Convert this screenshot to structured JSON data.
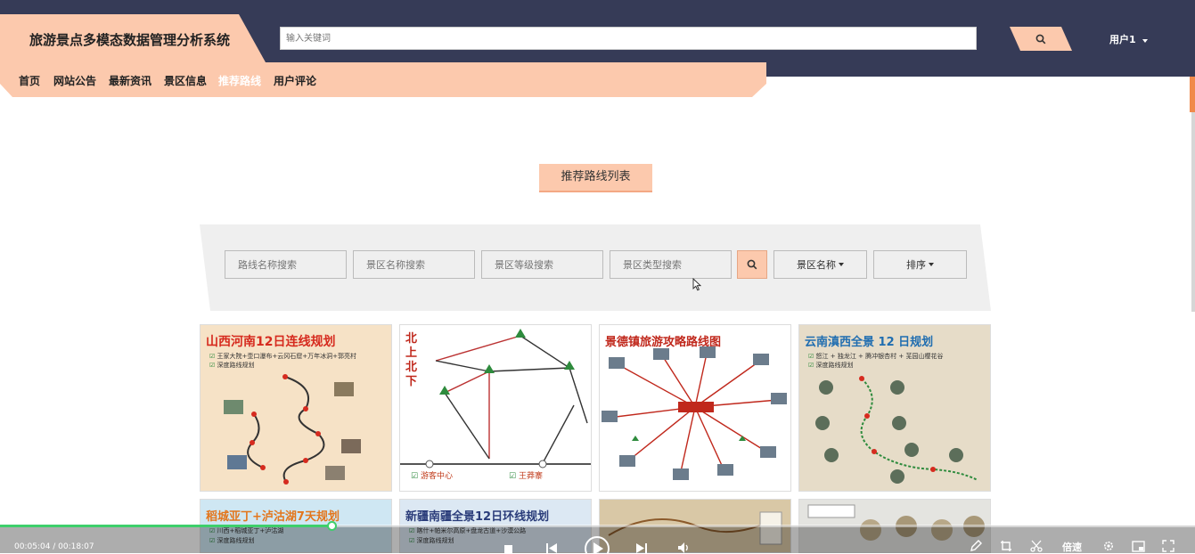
{
  "app": {
    "title": "旅游景点多模态数据管理分析系统"
  },
  "header": {
    "search_placeholder": "输入关键词",
    "user_label": "用户1"
  },
  "nav": {
    "items": [
      {
        "label": "首页",
        "active": false
      },
      {
        "label": "网站公告",
        "active": false
      },
      {
        "label": "最新资讯",
        "active": false
      },
      {
        "label": "景区信息",
        "active": false
      },
      {
        "label": "推荐路线",
        "active": true
      },
      {
        "label": "用户评论",
        "active": false
      }
    ]
  },
  "main": {
    "section_title": "推荐路线列表",
    "filters": {
      "route_name_placeholder": "路线名称搜索",
      "scenic_name_placeholder": "景区名称搜索",
      "scenic_level_placeholder": "景区等级搜索",
      "scenic_type_placeholder": "景区类型搜索",
      "scenic_dropdown_label": "景区名称",
      "sort_dropdown_label": "排序"
    },
    "cards": [
      {
        "title": "山西河南12日连线规划",
        "lines": [
          "王家大院+壶口瀑布+云冈石窟+万年冰洞+郭亮村",
          "深度路线规划"
        ],
        "title_color": "#d62b1f",
        "bg": "#f6e2c6"
      },
      {
        "title": "北上北下",
        "lines": [
          "游客中心",
          "王莽寨"
        ],
        "title_color": "#c0281c",
        "bg": "#ffffff"
      },
      {
        "title": "景德镇旅游攻略路线图",
        "lines": [],
        "title_color": "#c0281c",
        "bg": "#ffffff"
      },
      {
        "title": "云南滇西全景 12 日规划",
        "lines": [
          "怒江 + 独龙江 + 腾冲银杏村 + 芜园山樱花谷",
          "深度路线规划"
        ],
        "title_color": "#1f6db0",
        "bg": "#e6dcc8"
      },
      {
        "title": "稻城亚丁+泸沽湖7天规划",
        "lines": [
          "川西+稻城亚丁+泸沽湖",
          "深度路线规划"
        ],
        "title_color": "#e3761d",
        "bg": "#cfe7f3"
      },
      {
        "title": "新疆南疆全景12日环线规划",
        "lines": [
          "喀什+帕米尔高原+盘龙古道+沙漠公路",
          "深度路线规划"
        ],
        "title_color": "#2a3c7a",
        "bg": "#dce8f3"
      },
      {
        "title": "",
        "lines": [],
        "title_color": "#333333",
        "bg": "#d9c8a6"
      },
      {
        "title": "",
        "lines": [],
        "title_color": "#333333",
        "bg": "#e4e4e0"
      }
    ]
  },
  "player": {
    "time": "00:05:04 / 00:18:07",
    "speed_label": "倍速",
    "progress_fraction": 0.278
  },
  "colors": {
    "header_bg": "#363b57",
    "accent": "#fcc9ad",
    "progress": "#3ecf6b"
  }
}
